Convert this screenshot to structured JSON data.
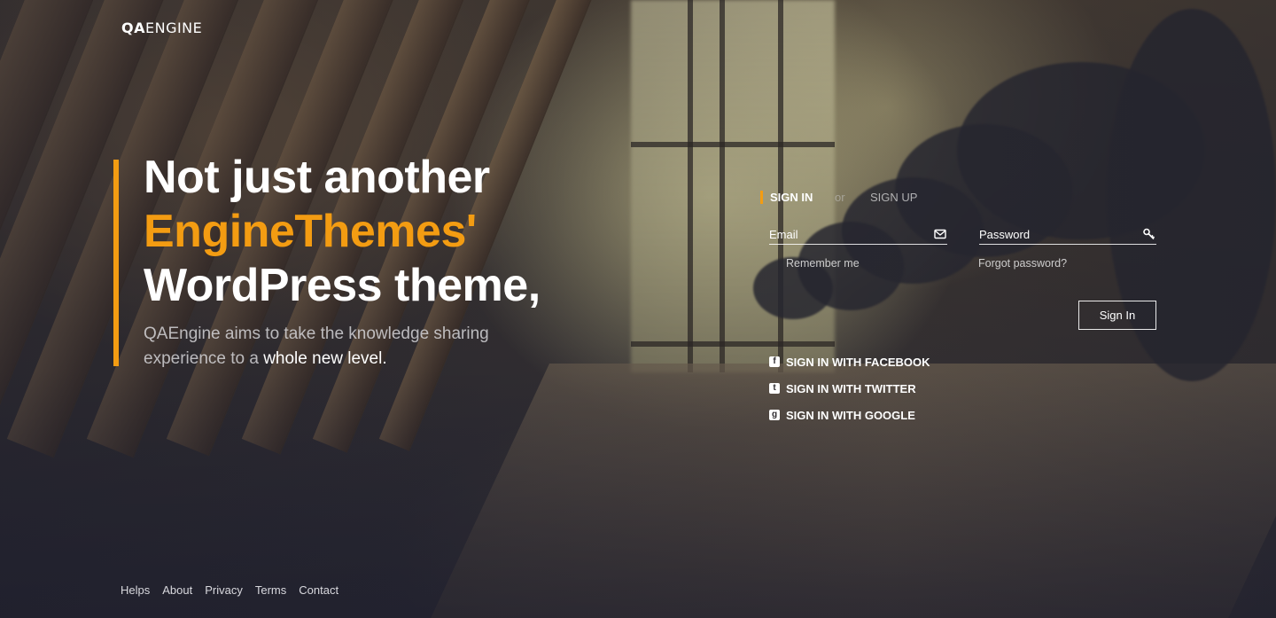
{
  "logo": {
    "bold": "QA",
    "light": "ENGINE"
  },
  "hero": {
    "title_line1": "Not just another",
    "title_line2": "EngineThemes'",
    "title_line3": "WordPress theme,",
    "subtitle_a": "QAEngine aims to take the knowledge sharing experience to a ",
    "subtitle_b": "whole new level."
  },
  "auth": {
    "tab_signin": "SIGN IN",
    "tab_or": "or",
    "tab_signup": "SIGN UP",
    "email_placeholder": "Email",
    "email_value": "",
    "password_placeholder": "Password",
    "password_value": "",
    "remember_label": "Remember me",
    "forgot_label": "Forgot password?",
    "submit_label": "Sign In"
  },
  "social": [
    {
      "label": "SIGN IN WITH FACEBOOK",
      "icon": "facebook-icon",
      "glyph": "f"
    },
    {
      "label": "SIGN IN WITH TWITTER",
      "icon": "twitter-icon",
      "glyph": "t"
    },
    {
      "label": "SIGN IN WITH GOOGLE",
      "icon": "google-plus-icon",
      "glyph": "g"
    }
  ],
  "footer": {
    "links": [
      "Helps",
      "About",
      "Privacy",
      "Terms",
      "Contact"
    ]
  },
  "colors": {
    "accent": "#f39c12",
    "text": "#ffffff"
  }
}
